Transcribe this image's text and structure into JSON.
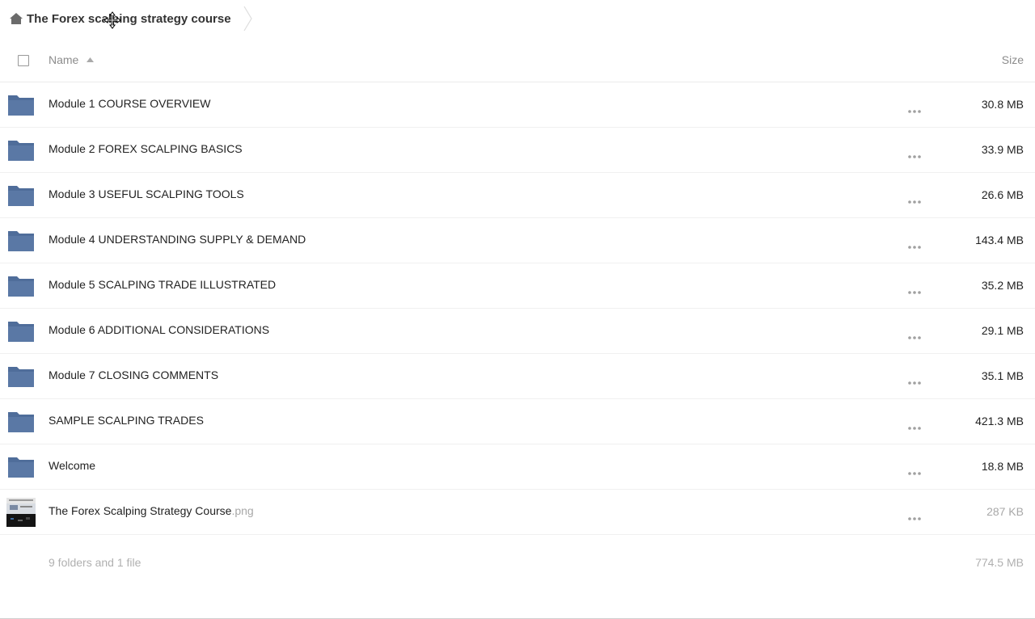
{
  "breadcrumb": {
    "home_icon": "home-icon",
    "current": "The Forex scalping strategy course"
  },
  "header": {
    "name_label": "Name",
    "size_label": "Size",
    "sort": "ascending"
  },
  "rows": [
    {
      "type": "folder",
      "name": "Module 1 COURSE OVERVIEW",
      "ext": "",
      "size": "30.8 MB"
    },
    {
      "type": "folder",
      "name": "Module 2 FOREX SCALPING BASICS",
      "ext": "",
      "size": "33.9 MB"
    },
    {
      "type": "folder",
      "name": "Module 3 USEFUL SCALPING TOOLS",
      "ext": "",
      "size": "26.6 MB"
    },
    {
      "type": "folder",
      "name": "Module 4 UNDERSTANDING SUPPLY & DEMAND",
      "ext": "",
      "size": "143.4 MB"
    },
    {
      "type": "folder",
      "name": "Module 5 SCALPING TRADE ILLUSTRATED",
      "ext": "",
      "size": "35.2 MB"
    },
    {
      "type": "folder",
      "name": "Module 6 ADDITIONAL CONSIDERATIONS",
      "ext": "",
      "size": "29.1 MB"
    },
    {
      "type": "folder",
      "name": "Module 7 CLOSING COMMENTS",
      "ext": "",
      "size": "35.1 MB"
    },
    {
      "type": "folder",
      "name": "SAMPLE SCALPING TRADES",
      "ext": "",
      "size": "421.3 MB"
    },
    {
      "type": "folder",
      "name": "Welcome",
      "ext": "",
      "size": "18.8 MB"
    },
    {
      "type": "file",
      "name": "The Forex Scalping Strategy Course",
      "ext": ".png",
      "size": "287 KB"
    }
  ],
  "summary": {
    "text": "9 folders and 1 file",
    "total_size": "774.5 MB"
  },
  "colors": {
    "folder": "#4f6d9a",
    "muted": "#a8a8a8"
  }
}
